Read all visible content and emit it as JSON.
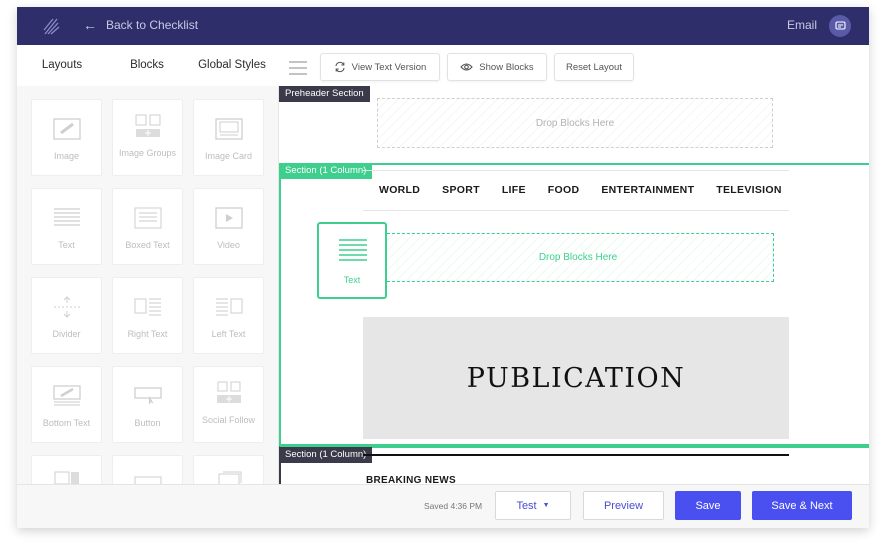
{
  "topbar": {
    "back_label": "Back to Checklist",
    "email_label": "Email"
  },
  "tabs": [
    {
      "label": "Layouts",
      "active": false
    },
    {
      "label": "Blocks",
      "active": true
    },
    {
      "label": "Global Styles",
      "active": false
    }
  ],
  "toolbar": {
    "view_text_label": "View Text Version",
    "show_blocks_label": "Show Blocks",
    "reset_layout_label": "Reset Layout"
  },
  "blocks": [
    {
      "label": "Image",
      "icon": "image-icon"
    },
    {
      "label": "Image Groups",
      "icon": "image-groups-icon"
    },
    {
      "label": "Image Card",
      "icon": "image-card-icon"
    },
    {
      "label": "Text",
      "icon": "text-icon"
    },
    {
      "label": "Boxed Text",
      "icon": "boxed-text-icon"
    },
    {
      "label": "Video",
      "icon": "video-icon"
    },
    {
      "label": "Divider",
      "icon": "divider-icon"
    },
    {
      "label": "Right Text",
      "icon": "right-text-icon"
    },
    {
      "label": "Left Text",
      "icon": "left-text-icon"
    },
    {
      "label": "Bottom Text",
      "icon": "bottom-text-icon"
    },
    {
      "label": "Button",
      "icon": "button-icon"
    },
    {
      "label": "Social Follow",
      "icon": "social-follow-icon"
    }
  ],
  "canvas": {
    "preheader_label": "Preheader Section",
    "drop_here": "Drop Blocks Here",
    "section1_label": "Section (1 Column)",
    "nav": [
      "WORLD",
      "SPORT",
      "LIFE",
      "FOOD",
      "ENTERTAINMENT",
      "TELEVISION"
    ],
    "dragging_block_label": "Text",
    "drop_here_active": "Drop Blocks Here",
    "publication": "PUBLICATION",
    "section2_label": "Section (1 Column)",
    "breaking": "BREAKING NEWS"
  },
  "bottombar": {
    "saved": "Saved 4:36 PM",
    "test_label": "Test",
    "preview_label": "Preview",
    "save_label": "Save",
    "save_next_label": "Save & Next"
  },
  "colors": {
    "topbar": "#2d2e6a",
    "accent_green": "#3ecf8e",
    "primary": "#4a4ff0",
    "section_label_dark": "#3a3a4a"
  }
}
